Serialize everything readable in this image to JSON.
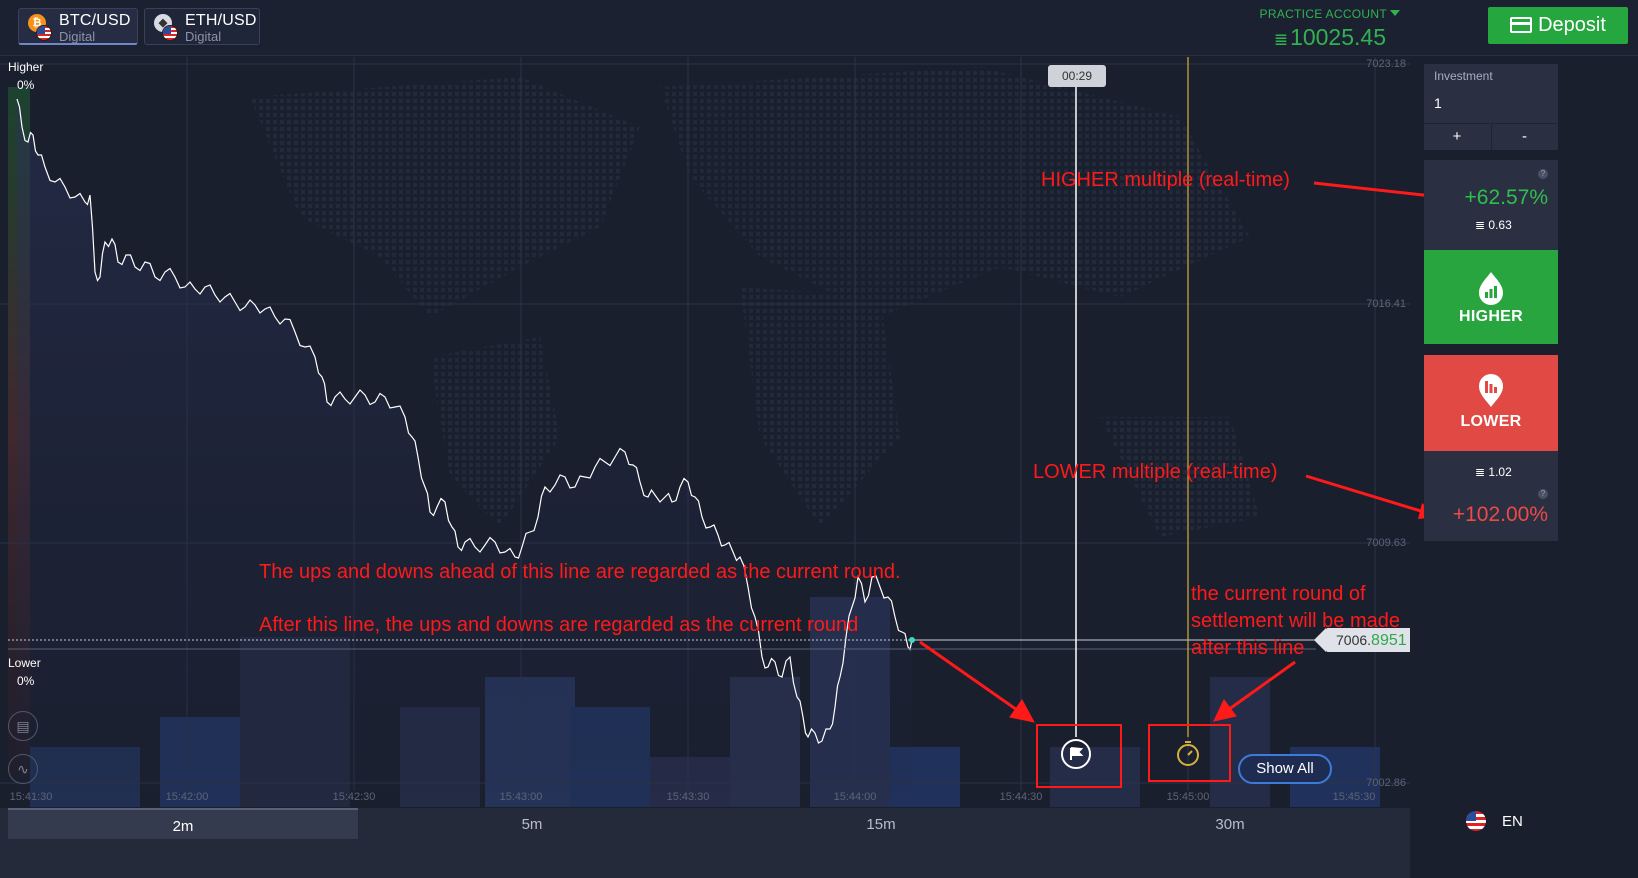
{
  "assets": [
    {
      "pair": "BTC/USD",
      "type": "Digital",
      "coin_symbol": "₿",
      "coin_color": "#f7931a",
      "active": true
    },
    {
      "pair": "ETH/USD",
      "type": "Digital",
      "coin_symbol": "◆",
      "coin_color": "#d9dbe3",
      "active": false
    }
  ],
  "account": {
    "mode": "PRACTICE ACCOUNT",
    "balance": "10025.45"
  },
  "deposit": {
    "label": "Deposit"
  },
  "chart": {
    "higher_label": "Higher",
    "higher_pct": "0%",
    "lower_label": "Lower",
    "lower_pct": "0%",
    "price_ticks": [
      "7023.18",
      "7016.41",
      "7009.63",
      "7002.86"
    ],
    "time_ticks": [
      "15:41:30",
      "15:42:00",
      "15:42:30",
      "15:43:00",
      "15:43:30",
      "15:44:00",
      "15:44:30",
      "15:45:00",
      "15:45:30"
    ],
    "countdown": "00:29",
    "current_price_prefix": "7006.",
    "current_price_suffix": "8951",
    "show_all": "Show All",
    "colors": {
      "line": "#ffffff",
      "current_marker": "#3fd6c2",
      "settle_line": "#d6b13a"
    }
  },
  "annotations": {
    "higher_multiple": "HIGHER multiple (real-time)",
    "lower_multiple": "LOWER multiple (real-time)",
    "round_ahead": "The ups and downs ahead of this line are regarded as the current round.",
    "round_after": "After this line, the ups and downs are regarded as the current round",
    "settlement_line1": "the current round of",
    "settlement_line2": "settlement will be made",
    "settlement_line3": "after this line",
    "color": "#ff1a1a"
  },
  "durations": [
    {
      "label": "2m",
      "active": true
    },
    {
      "label": "5m",
      "active": false
    },
    {
      "label": "15m",
      "active": false
    },
    {
      "label": "30m",
      "active": false
    }
  ],
  "language": "EN",
  "trade_panel": {
    "investment_label": "Investment",
    "investment_value": "1",
    "plus": "+",
    "minus": "-",
    "higher_pct": "+62.57%",
    "higher_payout": "0.63",
    "higher_button": "HIGHER",
    "lower_button": "LOWER",
    "lower_payout": "1.02",
    "lower_pct": "+102.00%",
    "help": "?",
    "colors": {
      "higher": "#28a53f",
      "lower": "#e14a44"
    }
  }
}
